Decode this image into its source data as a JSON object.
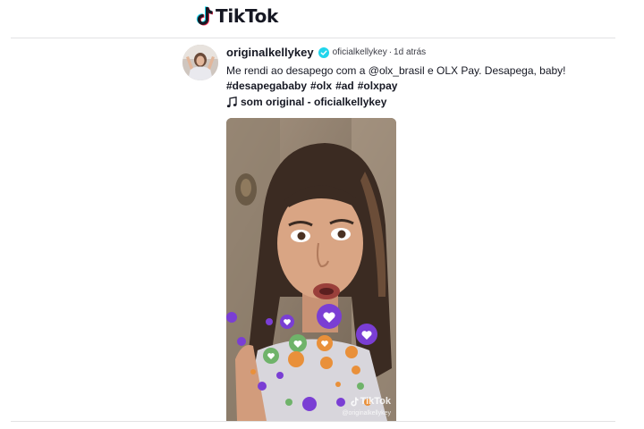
{
  "header": {
    "logo_text": "TikTok"
  },
  "post": {
    "username": "originalkellykey",
    "nickname": "oficialkellykey",
    "separator": "·",
    "time": "1d atrás",
    "caption": "Me rendi ao desapego com a @olx_brasil e OLX Pay. Desapega, baby!",
    "hashtags": [
      "#desapegababy",
      "#olx",
      "#ad",
      "#olxpay"
    ],
    "music": "som original - oficialkellykey"
  },
  "video": {
    "watermark": "TikTok",
    "watermark_user": "@originalkellykey"
  },
  "colors": {
    "text": "#161823",
    "verified": "#20d5ec",
    "divider": "#e3e3e4"
  }
}
